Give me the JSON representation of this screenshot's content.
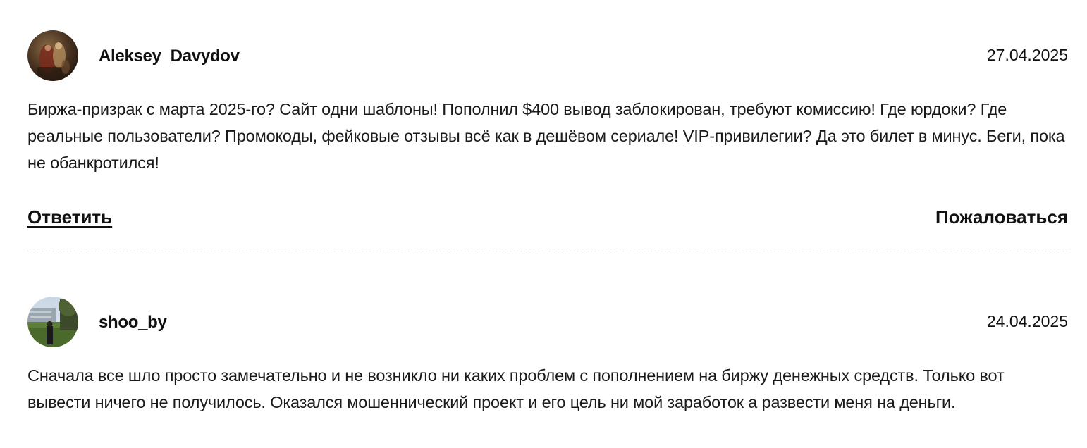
{
  "comments": [
    {
      "author": "Aleksey_Davydov",
      "date": "27.04.2025",
      "text": "Биржа-призрак с марта 2025-го? Сайт одни шаблоны! Пополнил $400 вывод заблокирован, требуют комиссию! Где юрдоки? Где реальные пользователи? Промокоды, фейковые отзывы всё как в дешёвом сериале! VIP-привилегии? Да это билет в минус. Беги, пока не обанкротился!",
      "reply_label": "Ответить",
      "report_label": "Пожаловаться"
    },
    {
      "author": "shoo_by",
      "date": "24.04.2025",
      "text": "Сначала все шло просто замечательно и не возникло ни каких проблем с пополнением на биржу денежных средств. Только вот вывести ничего не получилось. Оказался мошеннический проект и его цель ни мой заработок а развести меня на деньги."
    }
  ]
}
